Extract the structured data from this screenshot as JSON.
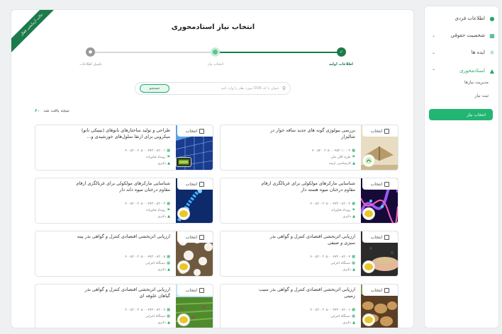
{
  "sidebar": {
    "items": [
      {
        "label": "اطلاعات فردی",
        "icon": "user-icon"
      },
      {
        "label": "شخصیت حقوقی",
        "icon": "building-icon"
      },
      {
        "label": "ایده ها",
        "icon": "bulb-icon"
      },
      {
        "label": "استادمحوری",
        "icon": "graduation-cap-icon"
      }
    ],
    "subitems": [
      "مدیریت نیازها",
      "ثبت نیاز"
    ],
    "active": "انتخاب نیاز"
  },
  "main": {
    "ribbon": "حالت آزمایشی فعال",
    "title": "انتخاب نیاز استادمحوری",
    "steps": [
      "اطلاعات اولیه",
      "انتخاب نیاز",
      "تکمیل اطلاعات"
    ],
    "search": {
      "placeholder": "عنوان یا کد DOR مورد نظر را وارد کنید",
      "button": "جستجو"
    },
    "result": {
      "count": "۶۰",
      "text": "نتیجه یافت شد"
    }
  },
  "cards": [
    {
      "select": "انتخاب",
      "title": "بررسی بیولوژی گونه های جدید ساقه خوار در شالیزار",
      "code": "۴۰۰۵۲۰۰۲۰۵۰۰۰۴۵۲۰۱۰۰۰۲",
      "meta2": "طرح کلان ملی",
      "meta3": "کارشناسی ارشد"
    },
    {
      "select": "انتخاب",
      "title": "طراحی و تولید ساختارهای نانوهای (نپتیکی نانو) میکروبی برای ارتقا سلول‌های خورشیدی و...",
      "code": "۴۰۰۵۲۰۰۲۰۵۰۰۰۴۷۳۰۰۸۲۰۰۱",
      "meta2": "رویداد فناورانه",
      "meta3": "دکتری"
    },
    {
      "select": "انتخاب",
      "title": "شناسایی مارکرهای مولکولی برای غربالگری ارقام مقاوم درختان میوه هسته دار",
      "code": "۴۰۰۵۲۰۰۲۰۵۰۰۰۴۷۳۰۰۸۲۰۰۲",
      "meta2": "رویداد فناورانه",
      "meta3": "دکتری"
    },
    {
      "select": "انتخاب",
      "title": "شناسایی مارکرهای مولکولی برای غربالگری ارقام مقاوم درختان میوه دانه دار",
      "code": "۴۰۰۵۲۰۰۲۰۵۰۰۰۴۷۳۰۰۸۲۰۰۳",
      "meta2": "رویداد فناورانه",
      "meta3": "دکتری"
    },
    {
      "select": "انتخاب",
      "title": "ارزیابی اثربخشی اقتصادی کنترل و گواهی بذر سبزی و صیفی",
      "code": "۴۰۰۵۲۰۰۲۰۵۰۰۰۴۷۳۰۰۸۲۰۰۴",
      "meta2": "دستگاه اجرایی",
      "meta3": "دکتری"
    },
    {
      "select": "انتخاب",
      "title": "ارزیابی اثربخشی اقتصادی کنترل و گواهی بذر پنبه",
      "code": "۴۰۰۵۲۰۰۲۰۵۰۰۰۴۷۳۰۰۸۲۰۰۵",
      "meta2": "دستگاه اجرایی",
      "meta3": "دکتری"
    },
    {
      "select": "انتخاب",
      "title": "ارزیابی اثربخشی اقتصادی کنترل و گواهی بذر سیب زمینی",
      "code": "۴۰۰۵۲۰۰۲۰۵۰۰۰۴۷۳۰۰۸۲۰۰۶",
      "meta2": "دستگاه اجرایی",
      "meta3": "دکتری"
    },
    {
      "select": "انتخاب",
      "title": "ارزیابی اثربخشی اقتصادی کنترل و گواهی بذر گیاهان علوفه ای",
      "code": "۴۰۰۵۲۰۰۲۰۵۰۰۰۴۷۳۰۰۸۲۰۰۷",
      "meta2": "دستگاه اجرایی",
      "meta3": "دکتری"
    }
  ],
  "colors": {
    "accent": "#22b573",
    "ribbon": "#1d7a4b"
  }
}
